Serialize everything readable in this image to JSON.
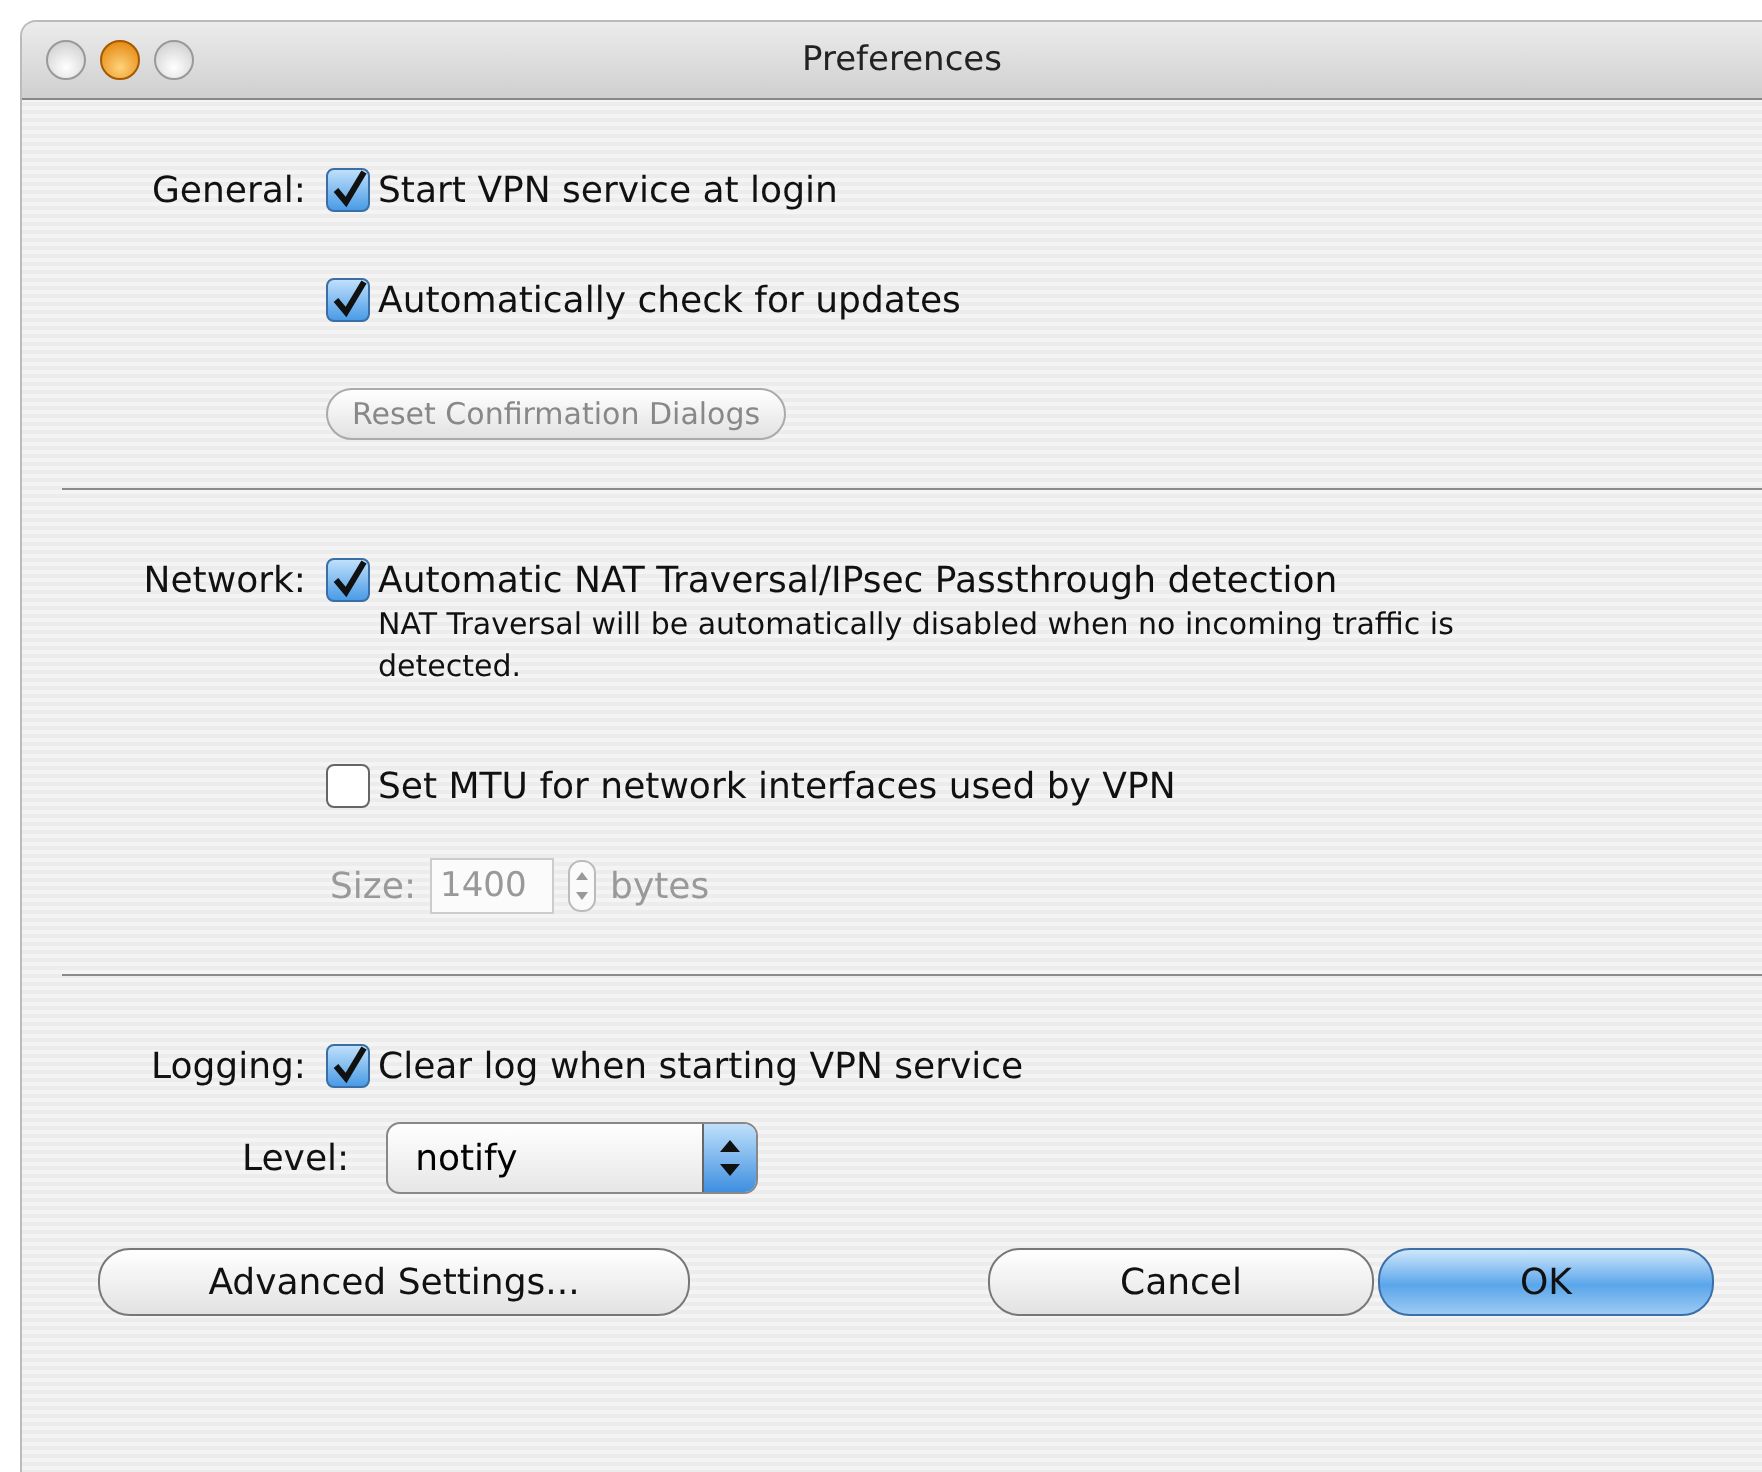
{
  "window": {
    "title": "Preferences"
  },
  "sections": [
    {
      "label": "General:",
      "items": [
        {
          "kind": "checkbox",
          "text": "Start VPN service at login",
          "checked": true
        },
        {
          "kind": "checkbox",
          "text": "Automatically check for updates",
          "checked": true
        },
        {
          "kind": "button",
          "text": "Reset Confirmation Dialogs",
          "disabled": true
        }
      ]
    },
    {
      "label": "Network:",
      "items": [
        {
          "kind": "checkbox",
          "text": "Automatic NAT Traversal/IPsec Passthrough detection",
          "checked": true
        },
        {
          "kind": "note",
          "text": "NAT Traversal will be automatically disabled when no incoming traffic is detected."
        },
        {
          "kind": "checkbox",
          "text": "Set MTU for network interfaces used by VPN",
          "checked": false
        },
        {
          "kind": "stepper",
          "label": "Size:",
          "value": "1400",
          "unit": "bytes",
          "disabled": true
        }
      ]
    },
    {
      "label": "Logging:",
      "items": [
        {
          "kind": "checkbox",
          "text": "Clear log when starting VPN service",
          "checked": true
        },
        {
          "kind": "popup",
          "label": "Level:",
          "value": "notify"
        }
      ]
    }
  ],
  "buttons": [
    {
      "text": "Advanced Settings...",
      "default": false
    },
    {
      "text": "Cancel",
      "default": false
    },
    {
      "text": "OK",
      "default": true
    }
  ]
}
